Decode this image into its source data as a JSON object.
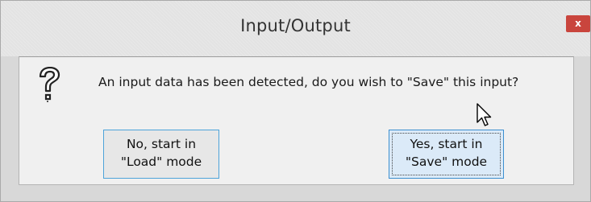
{
  "window": {
    "title": "Input/Output",
    "close_glyph": "x"
  },
  "message": {
    "icon": "question-mark-icon",
    "text": "An input data has been detected, do you wish to \"Save\" this input?"
  },
  "buttons": {
    "no": {
      "line1": "No, start in",
      "line2": "\"Load\" mode"
    },
    "yes": {
      "line1": "Yes, start in",
      "line2": "\"Save\" mode"
    }
  },
  "colors": {
    "close_button": "#c9453d",
    "button_border": "#4da3d9",
    "focused_button_fill": "#dbeaf8"
  }
}
